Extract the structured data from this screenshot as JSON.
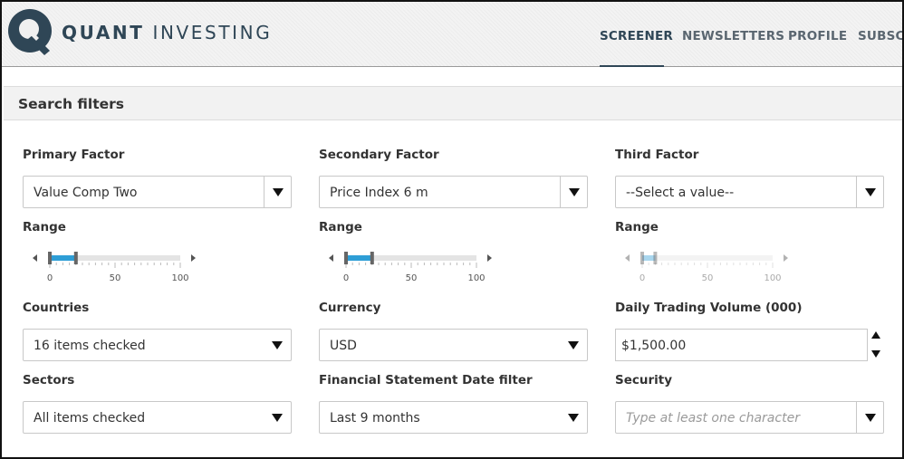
{
  "header": {
    "logo_bold": "QUANT",
    "logo_light": "INVESTING",
    "nav": [
      {
        "label": "SCREENER",
        "active": true
      },
      {
        "label": "NEWSLETTERS",
        "active": false
      },
      {
        "label": "PROFILE",
        "active": false
      },
      {
        "label": "SUBSCR",
        "active": false
      }
    ]
  },
  "panel": {
    "title": "Search filters"
  },
  "filters": {
    "primary": {
      "label": "Primary Factor",
      "value": "Value Comp Two",
      "range_label": "Range",
      "ticks": [
        "0",
        "50",
        "100"
      ],
      "range": [
        0,
        20
      ],
      "enabled": true
    },
    "secondary": {
      "label": "Secondary Factor",
      "value": "Price Index 6 m",
      "range_label": "Range",
      "ticks": [
        "0",
        "50",
        "100"
      ],
      "range": [
        0,
        20
      ],
      "enabled": true
    },
    "third": {
      "label": "Third Factor",
      "value": "--Select a value--",
      "range_label": "Range",
      "ticks": [
        "0",
        "50",
        "100"
      ],
      "range": [
        0,
        10
      ],
      "enabled": false
    },
    "countries": {
      "label": "Countries",
      "value": "16 items checked"
    },
    "currency": {
      "label": "Currency",
      "value": "USD"
    },
    "volume": {
      "label": "Daily Trading Volume (000)",
      "value": "$1,500.00"
    },
    "sectors": {
      "label": "Sectors",
      "value": "All items checked"
    },
    "fs_date": {
      "label": "Financial Statement Date filter",
      "value": "Last 9 months"
    },
    "security": {
      "label": "Security",
      "placeholder": "Type at least one character"
    }
  },
  "colors": {
    "brand": "#2f4656",
    "slider_active": "#2e9ed6",
    "slider_disabled": "#a9d6ee"
  },
  "icons": [
    "logo-q-icon",
    "dropdown-arrow-icon",
    "spin-up-icon",
    "spin-down-icon",
    "slider-left-arrow-icon",
    "slider-right-arrow-icon"
  ]
}
